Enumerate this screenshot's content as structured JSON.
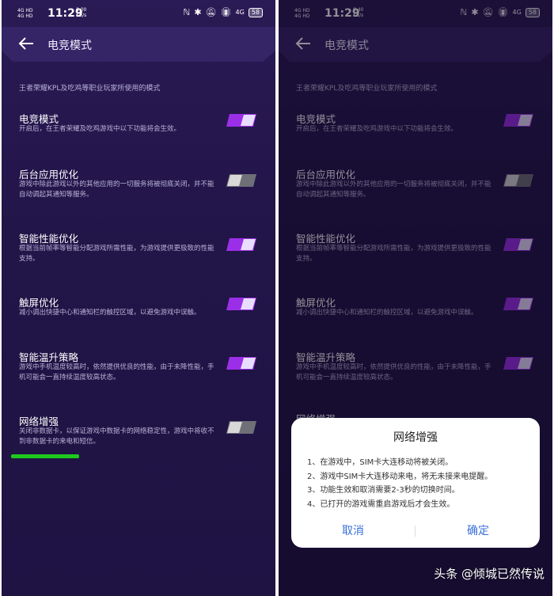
{
  "status_bar": {
    "network_top": "4G HD",
    "network_bottom": "4G HD",
    "time": "11:29",
    "speed_left": {
      "value": "0.00",
      "unit": "KB/s"
    },
    "speed_right": {
      "value": "0.40",
      "unit": "KB/s"
    },
    "right_icons": [
      "nfc-icon",
      "bluetooth-icon",
      "mute-icon",
      "vibrate-icon"
    ],
    "net_type": "4G",
    "battery": "58"
  },
  "header": {
    "title": "电竞模式"
  },
  "subtitle": "王者荣耀KPL及吃鸡等职业玩家所使用的模式",
  "settings": [
    {
      "title": "电竞模式",
      "desc": "开启后，在王者荣耀及吃鸡游戏中以下功能将会生效。",
      "enabled": true
    },
    {
      "title": "后台应用优化",
      "desc": "游戏中除此游戏以外的其他应用的一切服务将被彻底关闭，并不能自动调起其通知等服务。",
      "enabled": false
    },
    {
      "title": "智能性能优化",
      "desc": "根据当前帧率等智能分配游戏所需性能，为游戏提供更极致的性能支持。",
      "enabled": true
    },
    {
      "title": "触屏优化",
      "desc": "减小调出快捷中心和通知栏的触控区域，以避免游戏中误触。",
      "enabled": true
    },
    {
      "title": "智能温升策略",
      "desc": "游戏中手机温度较高时，依然提供优良的性能，由于未降性能，手机可能会一直持续温度较高状态。",
      "enabled": true
    },
    {
      "title": "网络增强",
      "desc": "关闭非数据卡，以保证游戏中数据卡的网络稳定性，游戏中将收不到非数据卡的来电和短信。",
      "enabled": false
    }
  ],
  "dialog": {
    "title": "网络增强",
    "lines": [
      "1、在游戏中，SIM卡大连移动将被关闭。",
      "2、游戏中SIM卡大连移动来电，将无未接来电提醒。",
      "3、功能生效和取消需要2-3秒的切换时间。",
      "4、已打开的游戏需重启游戏后才会生效。"
    ],
    "cancel_label": "取消",
    "ok_label": "确定"
  },
  "watermark": "头条 @倾城已然传说",
  "colors": {
    "toggle_on": "#9b2fe8",
    "toggle_off": "#8a8a8a",
    "dialog_button": "#3a6fd8",
    "home_indicator": "#1ec91e"
  }
}
